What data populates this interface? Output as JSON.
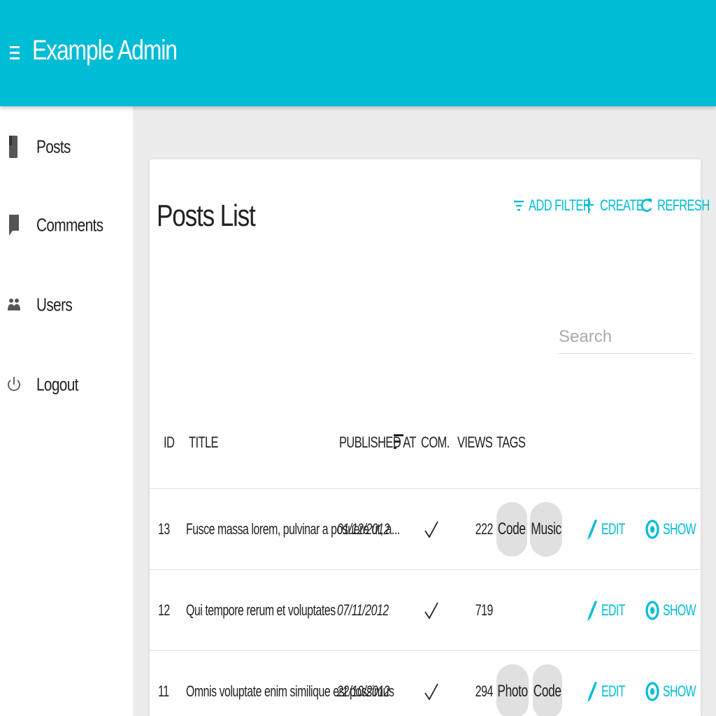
{
  "app": {
    "title": "Example Admin"
  },
  "colors": {
    "primary": "#00bcd4",
    "chip": "#e0e0e0",
    "background": "#ececec"
  },
  "sidebar": {
    "items": [
      {
        "label": "Posts",
        "icon": "book-icon"
      },
      {
        "label": "Comments",
        "icon": "comment-icon"
      },
      {
        "label": "Users",
        "icon": "people-icon"
      },
      {
        "label": "Logout",
        "icon": "power-icon"
      }
    ]
  },
  "list": {
    "title": "Posts List",
    "actions": {
      "filter": "ADD FILTER",
      "create": "CREATE",
      "refresh": "REFRESH"
    },
    "search_placeholder": "Search",
    "columns": {
      "id": "ID",
      "title": "TITLE",
      "published_at": "PUBLISHED AT",
      "comments": "COM.",
      "views": "VIEWS",
      "tags": "TAGS"
    },
    "sort_icon": "sort-icon",
    "row_actions": {
      "edit": "EDIT",
      "show": "SHOW"
    },
    "rows": [
      {
        "id": "13",
        "title": "Fusce massa lorem, pulvinar a posuere ut, a...",
        "published_at": "01/12/2012",
        "commentable": true,
        "views": "222",
        "tags": [
          "Code",
          "Music"
        ]
      },
      {
        "id": "12",
        "title": "Qui tempore rerum et voluptates",
        "published_at": "07/11/2012",
        "commentable": true,
        "views": "719",
        "tags": []
      },
      {
        "id": "11",
        "title": "Omnis voluptate enim similique est possimus",
        "published_at": "22/10/2012",
        "commentable": true,
        "views": "294",
        "tags": [
          "Photo",
          "Code"
        ]
      }
    ]
  }
}
